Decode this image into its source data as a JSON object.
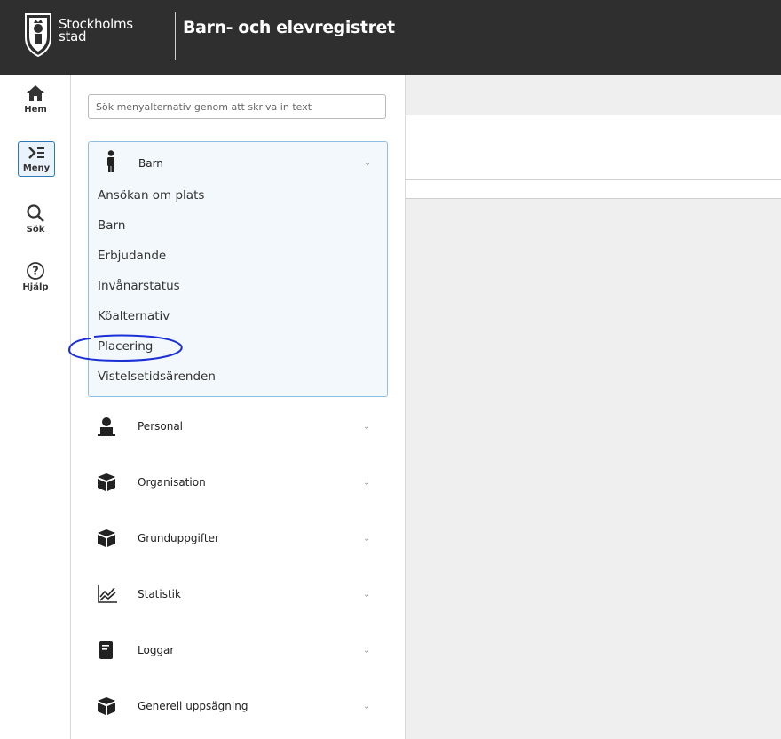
{
  "header": {
    "logo_line1": "Stockholms",
    "logo_line2": "stad",
    "app_title": "Barn- och elevregistret",
    "background": "#2f2f2f"
  },
  "rail": {
    "items": [
      {
        "label": "Hem",
        "icon": "home-icon"
      },
      {
        "label": "Meny",
        "icon": "menu-icon",
        "active": true
      },
      {
        "label": "Sök",
        "icon": "search-icon"
      },
      {
        "label": "Hjälp",
        "icon": "help-icon"
      }
    ]
  },
  "menu": {
    "search_placeholder": "Sök menyalternativ genom att skriva in text",
    "open_group": {
      "label": "Barn",
      "icon": "child-icon",
      "items": [
        "Ansökan om plats",
        "Barn",
        "Erbjudande",
        "Invånarstatus",
        "Köalternativ",
        "Placering",
        "Vistelsetidsärenden"
      ],
      "highlighted": "Placering"
    },
    "groups": [
      {
        "label": "Personal",
        "icon": "person-icon"
      },
      {
        "label": "Organisation",
        "icon": "box-icon"
      },
      {
        "label": "Grunduppgifter",
        "icon": "box-icon"
      },
      {
        "label": "Statistik",
        "icon": "chart-icon"
      },
      {
        "label": "Loggar",
        "icon": "book-icon"
      },
      {
        "label": "Generell uppsägning",
        "icon": "box-icon"
      }
    ],
    "chevron": "⌄"
  },
  "colors": {
    "accent": "#2b78b5",
    "annotation": "#1a2fd6"
  }
}
